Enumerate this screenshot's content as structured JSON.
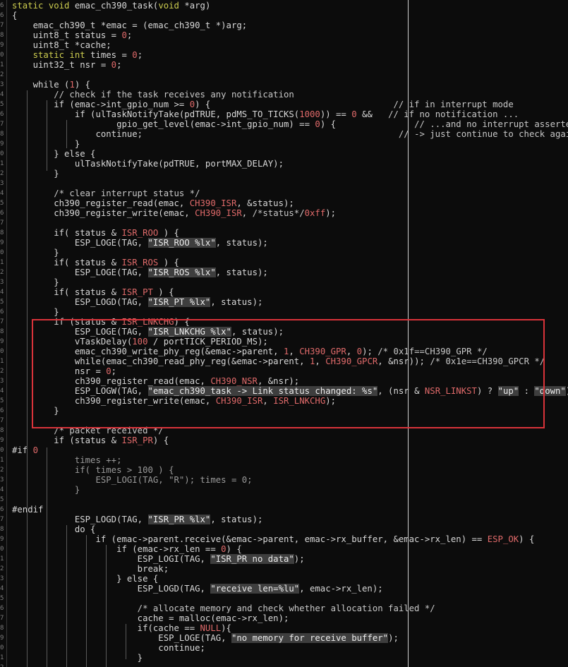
{
  "editor": {
    "line_prefixes": [
      "6",
      "6",
      "7",
      "8",
      "9",
      "0",
      "1",
      "2",
      "3",
      "4",
      "5",
      "6",
      "7",
      "8",
      "9",
      "0",
      "1",
      "2",
      "3",
      "4",
      "5",
      "6",
      "7",
      "8",
      "9",
      "0",
      "1",
      "2",
      "3",
      "4",
      "5",
      "6",
      "7",
      "8",
      "9",
      "0",
      "1",
      "2",
      "3",
      "4",
      "5",
      "6",
      "7",
      "8",
      "9",
      "0",
      "1",
      "2",
      "3",
      "4",
      "5",
      "6",
      "7",
      "8",
      "9",
      "0",
      "1",
      "2",
      "3",
      "4",
      "5",
      "6",
      "7",
      "8",
      "9",
      "0",
      "1",
      "2",
      "3"
    ],
    "lines": [
      [
        [
          "kw",
          "static void "
        ],
        [
          "",
          "emac_ch390_task("
        ],
        [
          "kw",
          "void "
        ],
        [
          "",
          "*arg)"
        ]
      ],
      [
        [
          "",
          "{"
        ]
      ],
      [
        [
          "",
          "    emac_ch390_t *emac = (emac_ch390_t *)arg;"
        ]
      ],
      [
        [
          "",
          "    uint8_t status = "
        ],
        [
          "nm",
          "0"
        ],
        [
          "",
          ";"
        ]
      ],
      [
        [
          "",
          "    uint8_t *cache;"
        ]
      ],
      [
        [
          "kw",
          "    static int "
        ],
        [
          "",
          "times = "
        ],
        [
          "nm",
          "0"
        ],
        [
          "",
          ";"
        ]
      ],
      [
        [
          "",
          "    uint32_t nsr = "
        ],
        [
          "nm",
          "0"
        ],
        [
          "",
          ";"
        ]
      ],
      [
        [
          "",
          ""
        ]
      ],
      [
        [
          "",
          "    while ("
        ],
        [
          "nm",
          "1"
        ],
        [
          "",
          ") {"
        ]
      ],
      [
        [
          "cm",
          "        // check if the task receives any notification"
        ]
      ],
      [
        [
          "",
          "        if (emac->int_gpio_num >= "
        ],
        [
          "nm",
          "0"
        ],
        [
          "",
          ") {                                   "
        ],
        [
          "cm",
          "// if in interrupt mode"
        ]
      ],
      [
        [
          "",
          "            if (ulTaskNotifyTake(pdTRUE, pdMS_TO_TICKS("
        ],
        [
          "nm",
          "1000"
        ],
        [
          "",
          ")) == "
        ],
        [
          "nm",
          "0"
        ],
        [
          "",
          " &&   "
        ],
        [
          "cm",
          "// if no notification ..."
        ]
      ],
      [
        [
          "",
          "                    gpio_get_level(emac->int_gpio_num) == "
        ],
        [
          "nm",
          "0"
        ],
        [
          "",
          ") {               "
        ],
        [
          "cm",
          "// ...and no interrupt asserted"
        ]
      ],
      [
        [
          "",
          "                continue;                                                 "
        ],
        [
          "cm",
          "// -> just continue to check again"
        ]
      ],
      [
        [
          "",
          "            }"
        ]
      ],
      [
        [
          "",
          "        } else {"
        ]
      ],
      [
        [
          "",
          "            ulTaskNotifyTake(pdTRUE, portMAX_DELAY);"
        ]
      ],
      [
        [
          "",
          "        }"
        ]
      ],
      [
        [
          "",
          ""
        ]
      ],
      [
        [
          "cm",
          "        /* clear interrupt status */"
        ]
      ],
      [
        [
          "",
          "        ch390_register_read(emac, "
        ],
        [
          "mc",
          "CH390_ISR"
        ],
        [
          "",
          ", &status);"
        ]
      ],
      [
        [
          "",
          "        ch390_register_write(emac, "
        ],
        [
          "mc",
          "CH390_ISR"
        ],
        [
          "",
          ", "
        ],
        [
          "cm",
          "/*status*/"
        ],
        [
          "nm",
          "0xff"
        ],
        [
          "",
          ");"
        ]
      ],
      [
        [
          "",
          ""
        ]
      ],
      [
        [
          "",
          "        if( status & "
        ],
        [
          "mc",
          "ISR_ROO"
        ],
        [
          "",
          " ) {"
        ]
      ],
      [
        [
          "",
          "            ESP_LOGE(TAG, "
        ],
        [
          "st",
          "\"ISR_ROO %lx\""
        ],
        [
          "",
          ", status);"
        ]
      ],
      [
        [
          "",
          "        }"
        ]
      ],
      [
        [
          "",
          "        if( status & "
        ],
        [
          "mc",
          "ISR_ROS"
        ],
        [
          "",
          " ) {"
        ]
      ],
      [
        [
          "",
          "            ESP_LOGE(TAG, "
        ],
        [
          "st",
          "\"ISR_ROS %lx\""
        ],
        [
          "",
          ", status);"
        ]
      ],
      [
        [
          "",
          "        }"
        ]
      ],
      [
        [
          "",
          "        if( status & "
        ],
        [
          "mc",
          "ISR_PT"
        ],
        [
          "",
          " ) {"
        ]
      ],
      [
        [
          "",
          "            ESP_LOGD(TAG, "
        ],
        [
          "st",
          "\"ISR_PT %lx\""
        ],
        [
          "",
          ", status);"
        ]
      ],
      [
        [
          "",
          "        }"
        ]
      ],
      [
        [
          "",
          "        if (status & "
        ],
        [
          "mc",
          "ISR_LNKCHG"
        ],
        [
          "",
          ") {"
        ]
      ],
      [
        [
          "",
          "            ESP_LOGE(TAG, "
        ],
        [
          "st",
          "\"ISR_LNKCHG %lx\""
        ],
        [
          "",
          ", status);"
        ]
      ],
      [
        [
          "",
          "            vTaskDelay("
        ],
        [
          "nm",
          "100"
        ],
        [
          "",
          " / portTICK_PERIOD_MS);"
        ]
      ],
      [
        [
          "",
          "            emac_ch390_write_phy_reg(&emac->parent, "
        ],
        [
          "nm",
          "1"
        ],
        [
          "",
          ", "
        ],
        [
          "mc",
          "CH390_GPR"
        ],
        [
          "",
          ", "
        ],
        [
          "nm",
          "0"
        ],
        [
          "",
          "); "
        ],
        [
          "cm",
          "/* 0x1f==CH390_GPR */"
        ]
      ],
      [
        [
          "",
          "            while(emac_ch390_read_phy_reg(&emac->parent, "
        ],
        [
          "nm",
          "1"
        ],
        [
          "",
          ", "
        ],
        [
          "mc",
          "CH390_GPCR"
        ],
        [
          "",
          ", &nsr)); "
        ],
        [
          "cm",
          "/* 0x1e==CH390_GPCR */"
        ]
      ],
      [
        [
          "",
          "            nsr = "
        ],
        [
          "nm",
          "0"
        ],
        [
          "",
          ";"
        ]
      ],
      [
        [
          "",
          "            ch390_register_read(emac, "
        ],
        [
          "mc",
          "CH390_NSR"
        ],
        [
          "",
          ", &nsr);"
        ]
      ],
      [
        [
          "",
          "            ESP_LOGW(TAG, "
        ],
        [
          "st",
          "\"emac_ch390_task -> Link status changed: %s\""
        ],
        [
          "",
          ", (nsr & "
        ],
        [
          "mc",
          "NSR_LINKST"
        ],
        [
          "",
          ") ? "
        ],
        [
          "st",
          "\"up\""
        ],
        [
          "",
          " : "
        ],
        [
          "st",
          "\"down\""
        ],
        [
          "",
          ");"
        ]
      ],
      [
        [
          "",
          "            ch390_register_write(emac, "
        ],
        [
          "mc",
          "CH390_ISR"
        ],
        [
          "",
          ", "
        ],
        [
          "mc",
          "ISR_LNKCHG"
        ],
        [
          "",
          ");"
        ]
      ],
      [
        [
          "",
          "        }"
        ]
      ],
      [
        [
          "",
          ""
        ]
      ],
      [
        [
          "cm",
          "        /* packet received */"
        ]
      ],
      [
        [
          "",
          "        if (status & "
        ],
        [
          "mc",
          "ISR_PR"
        ],
        [
          "",
          ") {"
        ]
      ],
      [
        [
          "pp",
          "#if "
        ],
        [
          "nm",
          "0"
        ]
      ],
      [
        [
          "cmkw",
          "            times ++;"
        ]
      ],
      [
        [
          "cmkw",
          "            if( times > 100 ) {"
        ]
      ],
      [
        [
          "cmkw",
          "                ESP_LOGI(TAG, \"R\"); times = 0;"
        ]
      ],
      [
        [
          "cmkw",
          "            }"
        ]
      ],
      [
        [
          "",
          ""
        ]
      ],
      [
        [
          "pp",
          "#endif"
        ]
      ],
      [
        [
          "",
          "            ESP_LOGD(TAG, "
        ],
        [
          "st",
          "\"ISR_PR %lx\""
        ],
        [
          "",
          ", status);"
        ]
      ],
      [
        [
          "",
          "            do {"
        ]
      ],
      [
        [
          "",
          "                if (emac->parent.receive(&emac->parent, emac->rx_buffer, &emac->rx_len) == "
        ],
        [
          "mc",
          "ESP_OK"
        ],
        [
          "",
          ") {"
        ]
      ],
      [
        [
          "",
          "                    if (emac->rx_len == "
        ],
        [
          "nm",
          "0"
        ],
        [
          "",
          ") {"
        ]
      ],
      [
        [
          "",
          "                        ESP_LOGI(TAG, "
        ],
        [
          "st",
          "\"ISR_PR no data\""
        ],
        [
          "",
          ");"
        ]
      ],
      [
        [
          "",
          "                        break;"
        ]
      ],
      [
        [
          "",
          "                    } else {"
        ]
      ],
      [
        [
          "",
          "                        ESP_LOGD(TAG, "
        ],
        [
          "st",
          "\"receive len=%lu\""
        ],
        [
          "",
          ", emac->rx_len);"
        ]
      ],
      [
        [
          "",
          ""
        ]
      ],
      [
        [
          "cm",
          "                        /* allocate memory and check whether allocation failed */"
        ]
      ],
      [
        [
          "",
          "                        cache = malloc(emac->rx_len);"
        ]
      ],
      [
        [
          "",
          "                        if(cache == "
        ],
        [
          "mc",
          "NULL"
        ],
        [
          "",
          "){"
        ]
      ],
      [
        [
          "",
          "                            ESP_LOGE(TAG, "
        ],
        [
          "st",
          "\"no memory for receive buffer\""
        ],
        [
          "",
          ");"
        ]
      ],
      [
        [
          "",
          "                            continue;"
        ]
      ],
      [
        [
          "",
          "                        }"
        ]
      ],
      [
        [
          "",
          ""
        ]
      ]
    ]
  }
}
